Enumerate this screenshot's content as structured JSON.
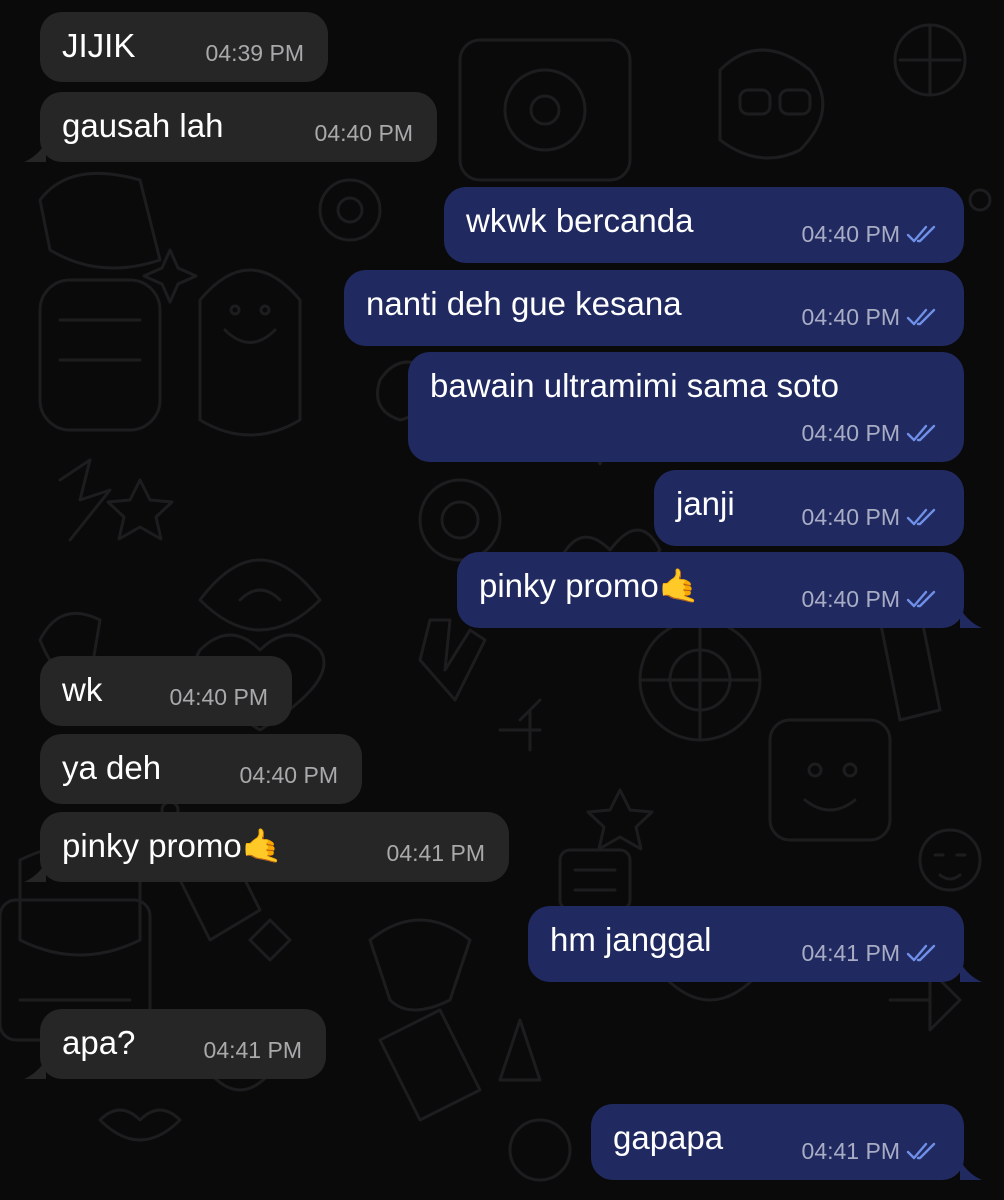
{
  "messages": [
    {
      "dir": "in",
      "text": "JIJIK",
      "time": "04:39 PM"
    },
    {
      "dir": "in",
      "text": "gausah lah",
      "time": "04:40 PM"
    },
    {
      "dir": "out",
      "text": "wkwk bercanda",
      "time": "04:40 PM"
    },
    {
      "dir": "out",
      "text": "nanti deh gue kesana",
      "time": "04:40 PM"
    },
    {
      "dir": "out",
      "text": "bawain ultramimi sama soto",
      "time": "04:40 PM"
    },
    {
      "dir": "out",
      "text": "janji",
      "time": "04:40 PM"
    },
    {
      "dir": "out",
      "text": "pinky promo🤙",
      "time": "04:40 PM"
    },
    {
      "dir": "in",
      "text": "wk",
      "time": "04:40 PM"
    },
    {
      "dir": "in",
      "text": "ya deh",
      "time": "04:40 PM"
    },
    {
      "dir": "in",
      "text": "pinky promo🤙",
      "time": "04:41 PM"
    },
    {
      "dir": "out",
      "text": "hm janggal",
      "time": "04:41 PM"
    },
    {
      "dir": "in",
      "text": "apa?",
      "time": "04:41 PM"
    },
    {
      "dir": "out",
      "text": "gapapa",
      "time": "04:41 PM"
    }
  ],
  "colors": {
    "background": "#0a0a0b",
    "incoming_bubble": "#262626",
    "outgoing_bubble": "#202a60",
    "read_ticks": "#6f8fe8"
  }
}
